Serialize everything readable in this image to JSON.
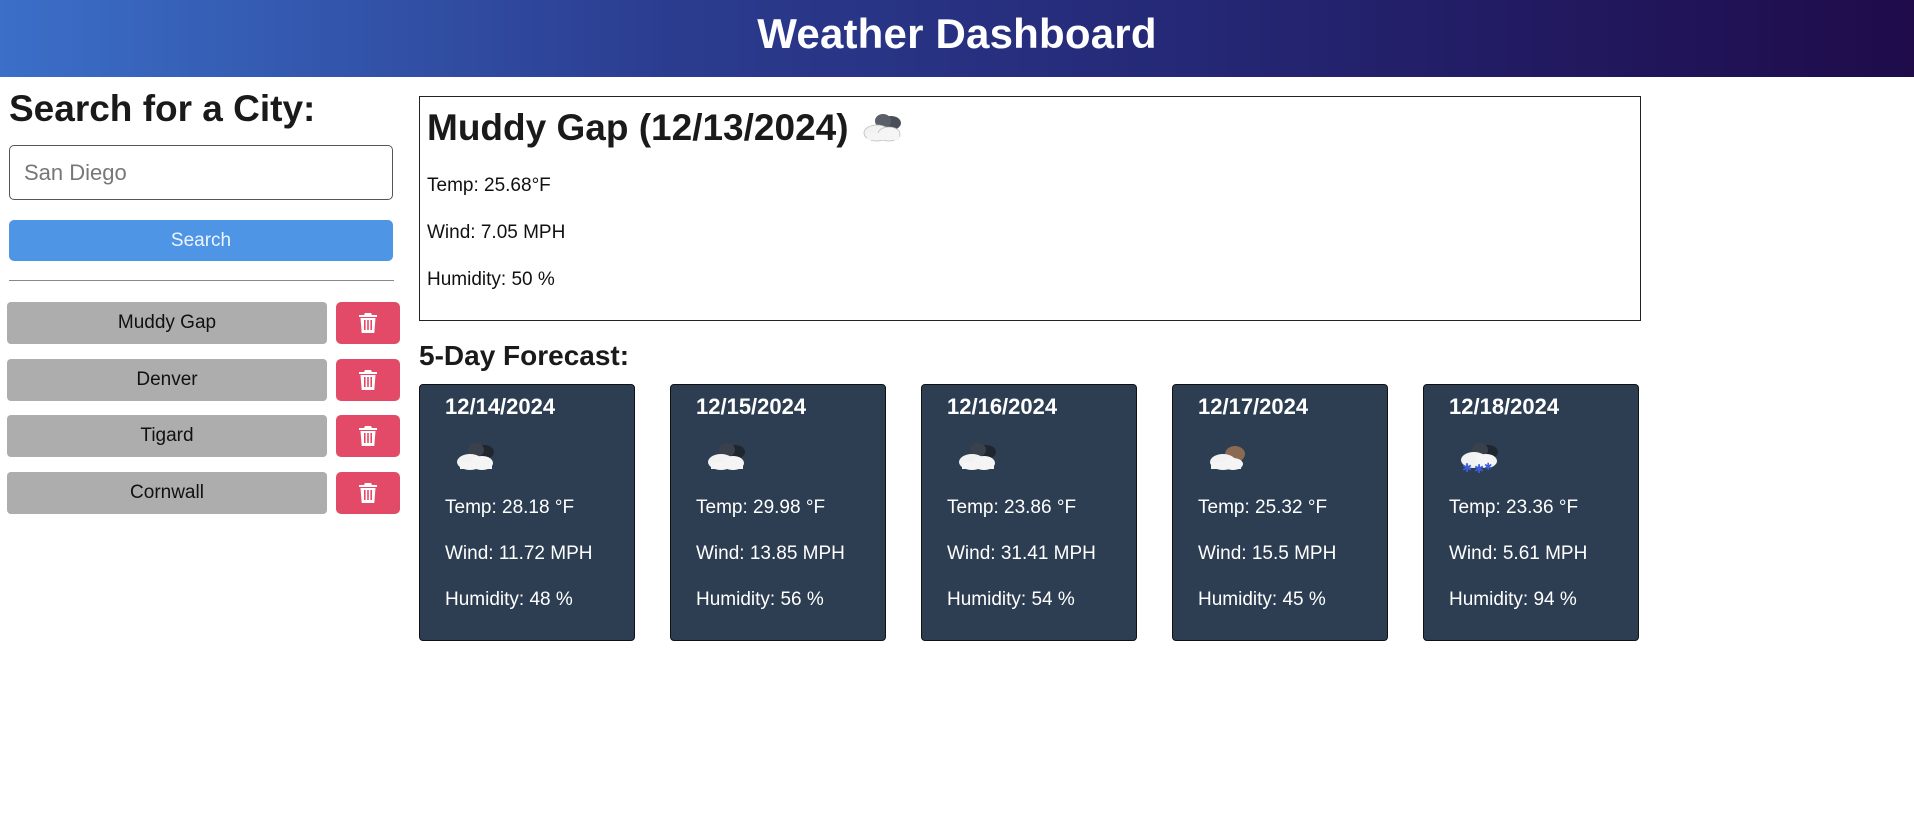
{
  "header": {
    "title": "Weather Dashboard"
  },
  "sidebar": {
    "heading": "Search for a City:",
    "search_placeholder": "San Diego",
    "search_label": "Search",
    "history": [
      {
        "city": "Muddy Gap",
        "delete_icon": "trash-icon"
      },
      {
        "city": "Denver",
        "delete_icon": "trash-icon"
      },
      {
        "city": "Tigard",
        "delete_icon": "trash-icon"
      },
      {
        "city": "Cornwall",
        "delete_icon": "trash-icon"
      }
    ]
  },
  "current": {
    "title": "Muddy Gap (12/13/2024)",
    "icon": "cloudy-icon",
    "temp": "Temp: 25.68°F",
    "wind": "Wind: 7.05 MPH",
    "humidity": "Humidity: 50 %"
  },
  "forecast": {
    "title": "5-Day Forecast:",
    "days": [
      {
        "date": "12/14/2024",
        "icon": "cloudy-icon",
        "temp": "Temp: 28.18 °F",
        "wind": "Wind: 11.72 MPH",
        "humidity": "Humidity: 48 %"
      },
      {
        "date": "12/15/2024",
        "icon": "cloudy-icon",
        "temp": "Temp: 29.98 °F",
        "wind": "Wind: 13.85 MPH",
        "humidity": "Humidity: 56 %"
      },
      {
        "date": "12/16/2024",
        "icon": "cloudy-icon",
        "temp": "Temp: 23.86 °F",
        "wind": "Wind: 31.41 MPH",
        "humidity": "Humidity: 54 %"
      },
      {
        "date": "12/17/2024",
        "icon": "broken-clouds-icon",
        "temp": "Temp: 25.32 °F",
        "wind": "Wind: 15.5 MPH",
        "humidity": "Humidity: 45 %"
      },
      {
        "date": "12/18/2024",
        "icon": "snow-icon",
        "temp": "Temp: 23.36 °F",
        "wind": "Wind: 5.61 MPH",
        "humidity": "Humidity: 94 %"
      }
    ]
  },
  "colors": {
    "header_gradient_start": "#3b6fc8",
    "header_gradient_end": "#1f0b4a",
    "search_button": "#4e95e6",
    "city_button": "#adadad",
    "delete_button": "#e24a68",
    "forecast_card": "#2d3e53"
  }
}
